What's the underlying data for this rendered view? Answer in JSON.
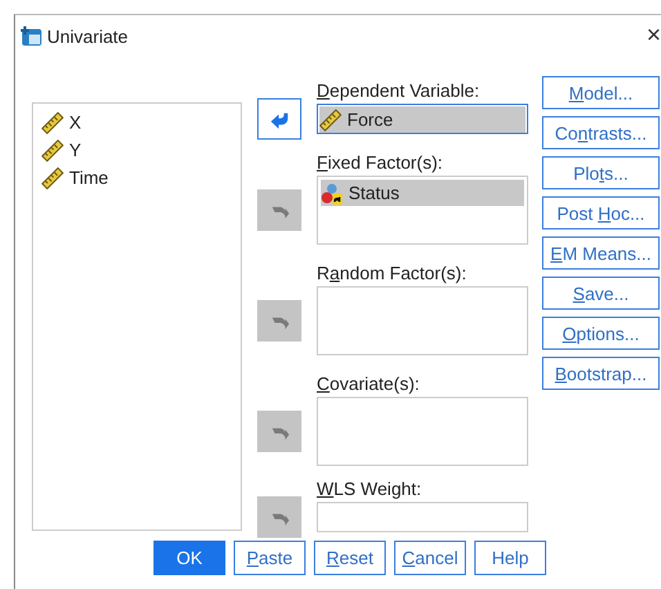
{
  "window": {
    "title": "Univariate",
    "close": "×"
  },
  "source_list": {
    "items": [
      {
        "name": "X",
        "kind": "scale",
        "selected": false
      },
      {
        "name": "Y",
        "kind": "scale",
        "selected": false
      },
      {
        "name": "Time",
        "kind": "scale",
        "selected": false
      }
    ]
  },
  "targets": [
    {
      "label": {
        "key": "D",
        "post": "ependent Variable:"
      },
      "kind": "field",
      "arrow": {
        "kind": "remove",
        "enabled": true
      },
      "items": [
        {
          "name": "Force",
          "kind": "scale",
          "selected": true
        }
      ],
      "focused": true
    },
    {
      "label": {
        "key": "F",
        "post": "ixed Factor(s):"
      },
      "kind": "list",
      "arrow": {
        "kind": "add",
        "enabled": false
      },
      "items": [
        {
          "name": "Status",
          "kind": "nominal",
          "selected": true
        }
      ],
      "focused": false
    },
    {
      "label": {
        "pre": "R",
        "key": "a",
        "post": "ndom Factor(s):"
      },
      "kind": "list",
      "arrow": {
        "kind": "add",
        "enabled": false
      },
      "focused": false
    },
    {
      "label": {
        "key": "C",
        "post": "ovariate(s):"
      },
      "kind": "list",
      "arrow": {
        "kind": "add",
        "enabled": false
      },
      "focused": false
    },
    {
      "label": {
        "key": "W",
        "post": "LS Weight:"
      },
      "kind": "field",
      "arrow": {
        "kind": "add",
        "enabled": false
      },
      "focused": false
    }
  ],
  "side_buttons": [
    {
      "label": {
        "key": "M",
        "post": "odel..."
      }
    },
    {
      "label": {
        "pre": "Co",
        "key": "n",
        "post": "trasts..."
      }
    },
    {
      "label": {
        "pre": "Plo",
        "key": "t",
        "post": "s..."
      }
    },
    {
      "label": {
        "pre": "Post ",
        "key": "H",
        "post": "oc..."
      }
    },
    {
      "label": {
        "key": "E",
        "post": "M Means..."
      }
    },
    {
      "label": {
        "key": "S",
        "post": "ave..."
      }
    },
    {
      "label": {
        "key": "O",
        "post": "ptions..."
      }
    },
    {
      "label": {
        "key": "B",
        "post": "ootstrap..."
      }
    }
  ],
  "bottom_buttons": [
    {
      "label": {
        "pre": "OK"
      },
      "default": true
    },
    {
      "label": {
        "key": "P",
        "post": "aste"
      },
      "default": false
    },
    {
      "label": {
        "key": "R",
        "post": "eset"
      },
      "default": false
    },
    {
      "label": {
        "key": "C",
        "post": "ancel"
      },
      "default": false
    },
    {
      "label": {
        "pre": "Help"
      },
      "default": false
    }
  ]
}
